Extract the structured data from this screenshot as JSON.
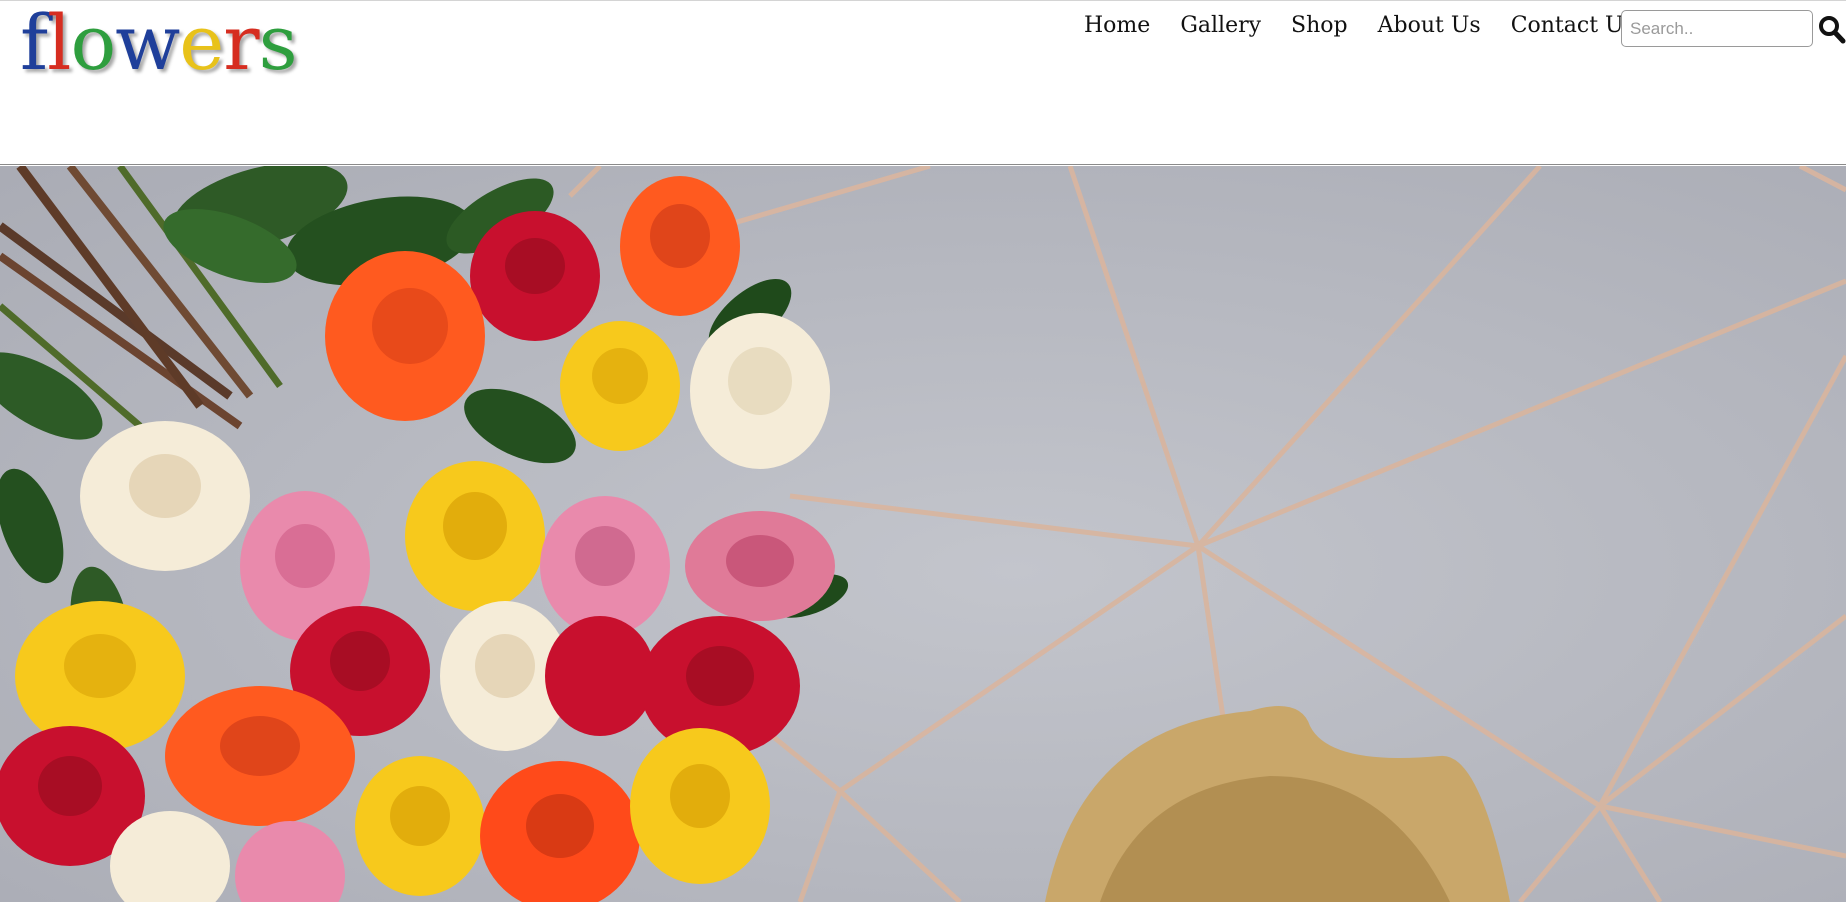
{
  "logo": {
    "letters": [
      {
        "char": "f",
        "color": "#1f3f9a"
      },
      {
        "char": "l",
        "color": "#d62d20"
      },
      {
        "char": "o",
        "color": "#2e9e3e"
      },
      {
        "char": "w",
        "color": "#1f3f9a"
      },
      {
        "char": "e",
        "color": "#e8c21a"
      },
      {
        "char": "r",
        "color": "#d62d20"
      },
      {
        "char": "s",
        "color": "#2e9e3e"
      }
    ]
  },
  "nav": {
    "home": "Home",
    "gallery": "Gallery",
    "shop": "Shop",
    "about": "About Us",
    "contact": "Contact Us"
  },
  "search": {
    "placeholder": "Search..",
    "icon": "search-icon"
  },
  "hero": {
    "background_color": "#b7b9c1",
    "line_color": "#d9b59e",
    "plate_color": "#c9a76a",
    "rose_colors": [
      "#c8102e",
      "#ff5a1f",
      "#f7c91c",
      "#f5ecd8",
      "#e98aac"
    ]
  }
}
